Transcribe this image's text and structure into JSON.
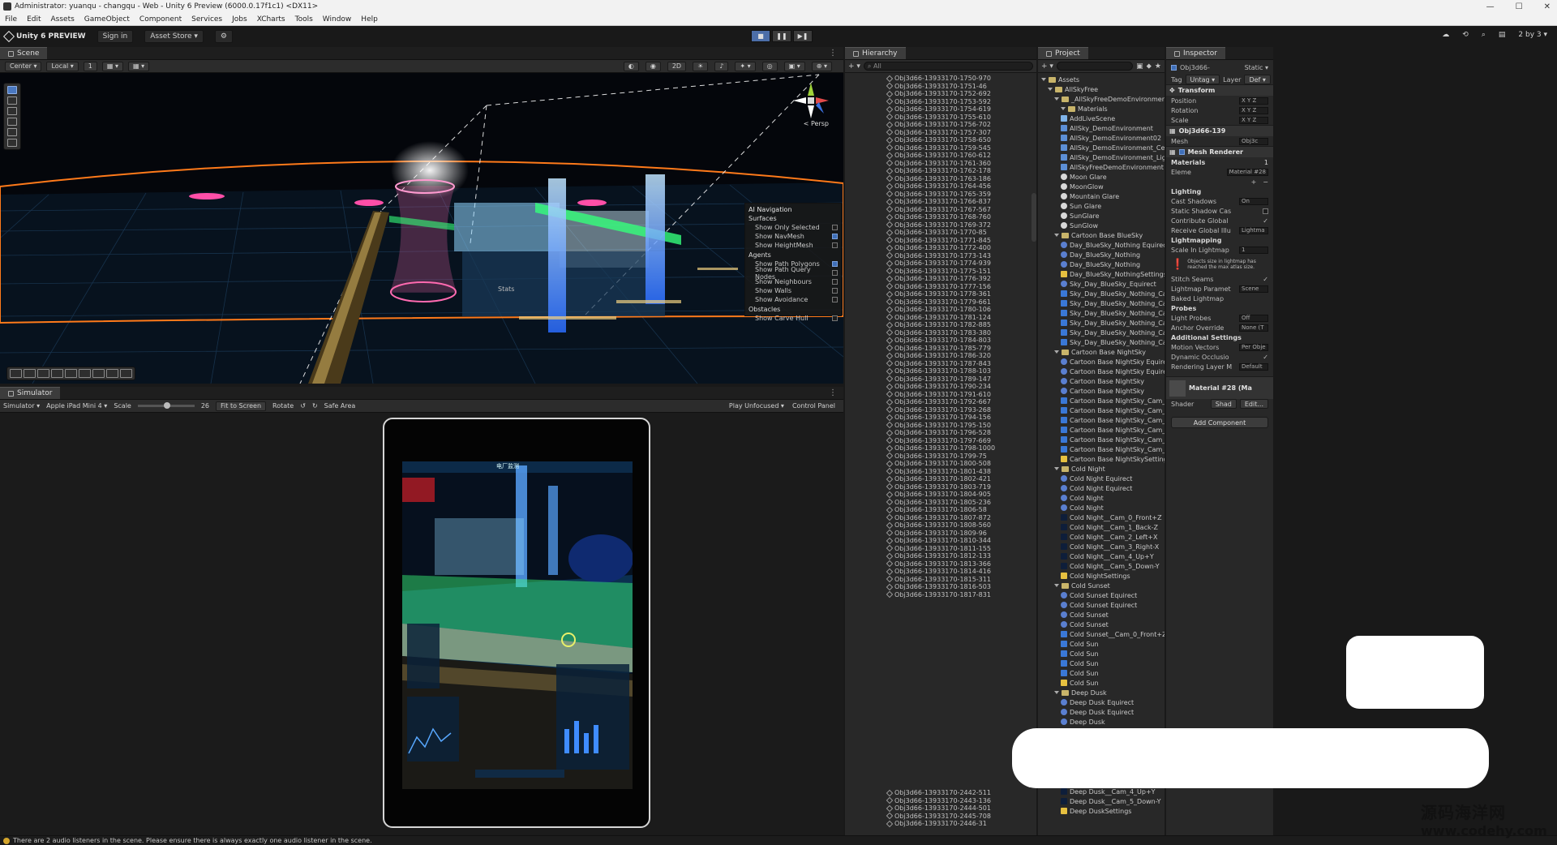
{
  "window": {
    "title": "Administrator: yuanqu - changqu - Web - Unity 6 Preview (6000.0.17f1c1) <DX11>",
    "controls": [
      "—",
      "☐",
      "✕"
    ]
  },
  "menu": [
    "File",
    "Edit",
    "Assets",
    "GameObject",
    "Component",
    "Services",
    "Jobs",
    "XCharts",
    "Tools",
    "Window",
    "Help"
  ],
  "toolbar": {
    "logo": "Unity 6 PREVIEW",
    "signin": "Sign in",
    "asset_store": "Asset Store ▾",
    "layout": "2 by 3 ▾"
  },
  "scene": {
    "tab": "Scene",
    "pivot": "Center ▾",
    "space": "Local ▾",
    "snap": "1",
    "persp": "< Persp",
    "stats_label": "Stats",
    "nav_overlay": {
      "title": "AI Navigation",
      "sections": [
        {
          "name": "Surfaces",
          "rows": [
            {
              "label": "Show Only Selected",
              "on": false
            },
            {
              "label": "Show NavMesh",
              "on": true
            },
            {
              "label": "Show HeightMesh",
              "on": false
            }
          ]
        },
        {
          "name": "Agents",
          "rows": [
            {
              "label": "Show Path Polygons",
              "on": true
            },
            {
              "label": "Show Path Query Nodes",
              "on": false
            },
            {
              "label": "Show Neighbours",
              "on": false
            },
            {
              "label": "Show Walls",
              "on": false
            },
            {
              "label": "Show Avoidance",
              "on": false
            }
          ]
        },
        {
          "name": "Obstacles",
          "rows": [
            {
              "label": "Show Carve Hull",
              "on": false
            }
          ]
        }
      ]
    }
  },
  "simulator": {
    "tab": "Simulator",
    "mode": "Simulator ▾",
    "device": "Apple iPad Mini 4 ▾",
    "scale_label": "Scale",
    "scale_value": "26",
    "fit": "Fit to Screen",
    "rotate": "Rotate",
    "safe_area": "Safe Area",
    "play_mode": "Play Unfocused ▾",
    "control_panel": "Control Panel",
    "screen_title": "电厂监测"
  },
  "hierarchy": {
    "tab": "Hierarchy",
    "search_placeholder": "All",
    "items": [
      "Obj3d66-13933170-1750-970",
      "Obj3d66-13933170-1751-46",
      "Obj3d66-13933170-1752-692",
      "Obj3d66-13933170-1753-592",
      "Obj3d66-13933170-1754-619",
      "Obj3d66-13933170-1755-610",
      "Obj3d66-13933170-1756-702",
      "Obj3d66-13933170-1757-307",
      "Obj3d66-13933170-1758-650",
      "Obj3d66-13933170-1759-545",
      "Obj3d66-13933170-1760-612",
      "Obj3d66-13933170-1761-360",
      "Obj3d66-13933170-1762-178",
      "Obj3d66-13933170-1763-186",
      "Obj3d66-13933170-1764-456",
      "Obj3d66-13933170-1765-359",
      "Obj3d66-13933170-1766-837",
      "Obj3d66-13933170-1767-567",
      "Obj3d66-13933170-1768-760",
      "Obj3d66-13933170-1769-372",
      "Obj3d66-13933170-1770-85",
      "Obj3d66-13933170-1771-845",
      "Obj3d66-13933170-1772-400",
      "Obj3d66-13933170-1773-143",
      "Obj3d66-13933170-1774-939",
      "Obj3d66-13933170-1775-151",
      "Obj3d66-13933170-1776-392",
      "Obj3d66-13933170-1777-156",
      "Obj3d66-13933170-1778-361",
      "Obj3d66-13933170-1779-661",
      "Obj3d66-13933170-1780-106",
      "Obj3d66-13933170-1781-124",
      "Obj3d66-13933170-1782-885",
      "Obj3d66-13933170-1783-380",
      "Obj3d66-13933170-1784-803",
      "Obj3d66-13933170-1785-779",
      "Obj3d66-13933170-1786-320",
      "Obj3d66-13933170-1787-843",
      "Obj3d66-13933170-1788-103",
      "Obj3d66-13933170-1789-147",
      "Obj3d66-13933170-1790-234",
      "Obj3d66-13933170-1791-610",
      "Obj3d66-13933170-1792-667",
      "Obj3d66-13933170-1793-268",
      "Obj3d66-13933170-1794-156",
      "Obj3d66-13933170-1795-150",
      "Obj3d66-13933170-1796-528",
      "Obj3d66-13933170-1797-669",
      "Obj3d66-13933170-1798-1000",
      "Obj3d66-13933170-1799-75",
      "Obj3d66-13933170-1800-508",
      "Obj3d66-13933170-1801-438",
      "Obj3d66-13933170-1802-421",
      "Obj3d66-13933170-1803-719",
      "Obj3d66-13933170-1804-905",
      "Obj3d66-13933170-1805-236",
      "Obj3d66-13933170-1806-58",
      "Obj3d66-13933170-1807-872",
      "Obj3d66-13933170-1808-560",
      "Obj3d66-13933170-1809-96",
      "Obj3d66-13933170-1810-344",
      "Obj3d66-13933170-1811-155",
      "Obj3d66-13933170-1812-133",
      "Obj3d66-13933170-1813-366",
      "Obj3d66-13933170-1814-416",
      "Obj3d66-13933170-1815-311",
      "Obj3d66-13933170-1816-503",
      "Obj3d66-13933170-1817-831"
    ],
    "bottom_items": [
      "Obj3d66-13933170-2442-511",
      "Obj3d66-13933170-2443-136",
      "Obj3d66-13933170-2444-501",
      "Obj3d66-13933170-2445-708",
      "Obj3d66-13933170-2446-31"
    ]
  },
  "project": {
    "tab": "Project",
    "tree": [
      {
        "t": "folder",
        "d": 0,
        "l": "Assets"
      },
      {
        "t": "folder",
        "d": 1,
        "l": "AllSkyFree"
      },
      {
        "t": "folder",
        "d": 2,
        "l": "_AllSkyFreeDemoEnvironment"
      },
      {
        "t": "folder",
        "d": 3,
        "l": "Materials"
      },
      {
        "t": "script",
        "d": 3,
        "l": "AddLiveScene"
      },
      {
        "t": "asset",
        "d": 3,
        "l": "AllSky_DemoEnvironment"
      },
      {
        "t": "asset",
        "d": 3,
        "l": "AllSky_DemoEnvironment02"
      },
      {
        "t": "asset",
        "d": 3,
        "l": "AllSky_DemoEnvironment_Ce"
      },
      {
        "t": "asset",
        "d": 3,
        "l": "AllSky_DemoEnvironment_Ligl"
      },
      {
        "t": "asset",
        "d": 3,
        "l": "AllSkyFreeDemoEnvironment"
      },
      {
        "t": "tex",
        "d": 3,
        "l": "Moon Glare"
      },
      {
        "t": "tex",
        "d": 3,
        "l": "MoonGlow"
      },
      {
        "t": "tex",
        "d": 3,
        "l": "Mountain Glare"
      },
      {
        "t": "tex",
        "d": 3,
        "l": "Sun Glare"
      },
      {
        "t": "tex",
        "d": 3,
        "l": "SunGlare"
      },
      {
        "t": "tex",
        "d": 3,
        "l": "SunGlow"
      },
      {
        "t": "folder",
        "d": 2,
        "l": "Cartoon Base BlueSky"
      },
      {
        "t": "mat",
        "d": 3,
        "l": "Day_BlueSky_Nothing Equirect"
      },
      {
        "t": "mat",
        "d": 3,
        "l": "Day_BlueSky_Nothing"
      },
      {
        "t": "mat",
        "d": 3,
        "l": "Day_BlueSky_Nothing"
      },
      {
        "t": "light",
        "d": 3,
        "l": "Day_BlueSky_NothingSettings"
      },
      {
        "t": "mat",
        "d": 3,
        "l": "Sky_Day_BlueSky_Equirect"
      },
      {
        "t": "img",
        "d": 3,
        "l": "Sky_Day_BlueSky_Nothing_Ca"
      },
      {
        "t": "img",
        "d": 3,
        "l": "Sky_Day_BlueSky_Nothing_Ca"
      },
      {
        "t": "img",
        "d": 3,
        "l": "Sky_Day_BlueSky_Nothing_Ca"
      },
      {
        "t": "img",
        "d": 3,
        "l": "Sky_Day_BlueSky_Nothing_Ca"
      },
      {
        "t": "img",
        "d": 3,
        "l": "Sky_Day_BlueSky_Nothing_Ca"
      },
      {
        "t": "img",
        "d": 3,
        "l": "Sky_Day_BlueSky_Nothing_Ca"
      },
      {
        "t": "folder",
        "d": 2,
        "l": "Cartoon Base NightSky"
      },
      {
        "t": "mat",
        "d": 3,
        "l": "Cartoon Base NightSky Equire"
      },
      {
        "t": "mat",
        "d": 3,
        "l": "Cartoon Base NightSky Equire"
      },
      {
        "t": "mat",
        "d": 3,
        "l": "Cartoon Base NightSky"
      },
      {
        "t": "mat",
        "d": 3,
        "l": "Cartoon Base NightSky"
      },
      {
        "t": "img",
        "d": 3,
        "l": "Cartoon Base NightSky_Cam_"
      },
      {
        "t": "img",
        "d": 3,
        "l": "Cartoon Base NightSky_Cam_"
      },
      {
        "t": "img",
        "d": 3,
        "l": "Cartoon Base NightSky_Cam_"
      },
      {
        "t": "img",
        "d": 3,
        "l": "Cartoon Base NightSky_Cam_"
      },
      {
        "t": "img",
        "d": 3,
        "l": "Cartoon Base NightSky_Cam_"
      },
      {
        "t": "img",
        "d": 3,
        "l": "Cartoon Base NightSky_Cam_"
      },
      {
        "t": "light",
        "d": 3,
        "l": "Cartoon Base NightSkySetting"
      },
      {
        "t": "folder",
        "d": 2,
        "l": "Cold Night"
      },
      {
        "t": "mat",
        "d": 3,
        "l": "Cold Night Equirect"
      },
      {
        "t": "mat",
        "d": 3,
        "l": "Cold Night Equirect"
      },
      {
        "t": "mat",
        "d": 3,
        "l": "Cold Night"
      },
      {
        "t": "mat",
        "d": 3,
        "l": "Cold Night"
      },
      {
        "t": "dark",
        "d": 3,
        "l": "Cold Night__Cam_0_Front+Z"
      },
      {
        "t": "dark",
        "d": 3,
        "l": "Cold Night__Cam_1_Back-Z"
      },
      {
        "t": "dark",
        "d": 3,
        "l": "Cold Night__Cam_2_Left+X"
      },
      {
        "t": "dark",
        "d": 3,
        "l": "Cold Night__Cam_3_Right-X"
      },
      {
        "t": "dark",
        "d": 3,
        "l": "Cold Night__Cam_4_Up+Y"
      },
      {
        "t": "dark",
        "d": 3,
        "l": "Cold Night__Cam_5_Down-Y"
      },
      {
        "t": "light",
        "d": 3,
        "l": "Cold NightSettings"
      },
      {
        "t": "folder",
        "d": 2,
        "l": "Cold Sunset"
      },
      {
        "t": "mat",
        "d": 3,
        "l": "Cold Sunset Equirect"
      },
      {
        "t": "mat",
        "d": 3,
        "l": "Cold Sunset Equirect"
      },
      {
        "t": "mat",
        "d": 3,
        "l": "Cold Sunset"
      },
      {
        "t": "mat",
        "d": 3,
        "l": "Cold Sunset"
      },
      {
        "t": "img",
        "d": 3,
        "l": "Cold Sunset__Cam_0_Front+Z"
      },
      {
        "t": "img",
        "d": 3,
        "l": "Cold Sun"
      },
      {
        "t": "img",
        "d": 3,
        "l": "Cold Sun"
      },
      {
        "t": "img",
        "d": 3,
        "l": "Cold Sun"
      },
      {
        "t": "img",
        "d": 3,
        "l": "Cold Sun"
      },
      {
        "t": "light",
        "d": 3,
        "l": "Cold Sun"
      },
      {
        "t": "folder",
        "d": 2,
        "l": "Deep Dusk"
      },
      {
        "t": "mat",
        "d": 3,
        "l": "Deep Dusk Equirect"
      },
      {
        "t": "mat",
        "d": 3,
        "l": "Deep Dusk Equirect"
      },
      {
        "t": "mat",
        "d": 3,
        "l": "Deep Dusk"
      }
    ],
    "bottom_tree": [
      {
        "t": "dark",
        "d": 3,
        "l": "Deep Dusk__Cam_4_Up+Y"
      },
      {
        "t": "dark",
        "d": 3,
        "l": "Deep Dusk__Cam_5_Down-Y"
      },
      {
        "t": "light",
        "d": 3,
        "l": "Deep DuskSettings"
      }
    ]
  },
  "inspector": {
    "tab": "Inspector",
    "object_name": "Obj3d66-",
    "static": "Static ▾",
    "tag_label": "Tag",
    "tag": "Untag ▾",
    "layer_label": "Layer",
    "layer": "Def ▾",
    "transform": {
      "title": "Transform",
      "rows": [
        {
          "l": "Position",
          "v": "X   Y   Z"
        },
        {
          "l": "Rotation",
          "v": "X   Y   Z"
        },
        {
          "l": "Scale",
          "v": "X   Y   Z"
        }
      ]
    },
    "mesh_filter": {
      "title": "Obj3d66-139",
      "mesh_label": "Mesh",
      "mesh_value": "Obj3c"
    },
    "mesh_renderer": {
      "title": "Mesh Renderer"
    },
    "materials_label": "Materials",
    "materials_count": "1",
    "element": "Eleme",
    "element_value": "Material #28",
    "lighting_label": "Lighting",
    "lighting_rows": [
      {
        "l": "Cast Shadows",
        "v": "On"
      },
      {
        "l": "Static Shadow Cas",
        "v": ""
      },
      {
        "l": "Contribute Global",
        "v": "✓"
      },
      {
        "l": "Receive Global Illu",
        "v": "Lightma"
      }
    ],
    "lightmapping_label": "Lightmapping",
    "scale_lightmap": {
      "l": "Scale In Lightmap",
      "v": "1"
    },
    "warn_text": "Objects size in lightmap has reached the max atlas size.",
    "stitch": {
      "l": "Stitch Seams",
      "v": "✓"
    },
    "lightmap_param": {
      "l": "Lightmap Paramet",
      "v": "Scene"
    },
    "baked": "Baked Lightmap",
    "probes_label": "Probes",
    "probes_rows": [
      {
        "l": "Light Probes",
        "v": "Off"
      },
      {
        "l": "Anchor Override",
        "v": "None (T"
      }
    ],
    "additional_label": "Additional Settings",
    "additional_rows": [
      {
        "l": "Motion Vectors",
        "v": "Per Obje"
      },
      {
        "l": "Dynamic Occlusio",
        "v": "✓"
      },
      {
        "l": "Rendering Layer M",
        "v": "Default"
      }
    ],
    "material_title": "Material #28 (Ma",
    "shader_label": "Shader",
    "shader_value": "Shad",
    "edit": "Edit...",
    "add_component": "Add Component"
  },
  "status": {
    "message": "There are 2 audio listeners in the scene. Please ensure there is always exactly one audio listener in the scene."
  },
  "watermark": {
    "line1": "源码海洋网",
    "line2": "www.codehy.com"
  }
}
